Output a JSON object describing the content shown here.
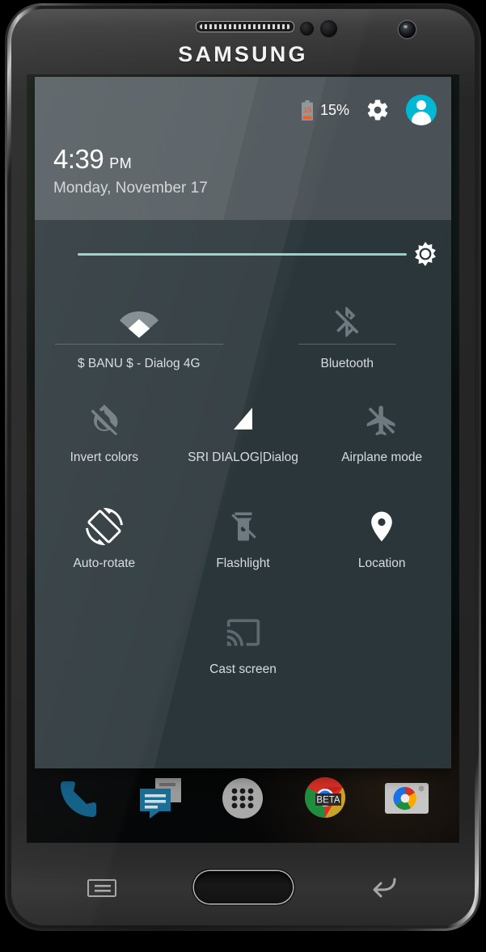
{
  "device": {
    "brand": "SAMSUNG",
    "speaker_icon": "earpiece-speaker",
    "camera_icon": "front-camera",
    "home_button": "home-button",
    "recent_button": "recent-apps-button",
    "back_button": "back-button"
  },
  "status": {
    "battery_level_text": "15",
    "battery_percent": "15%",
    "battery_icon": "battery-low-icon",
    "settings_icon": "gear-icon",
    "avatar_icon": "user-avatar-icon",
    "accent_cyan": "#00b8d4",
    "battery_warn_color": "#f4511e"
  },
  "clock": {
    "time": "4:39",
    "ampm": "PM",
    "date": "Monday, November 17"
  },
  "brightness": {
    "label": "brightness-slider",
    "value_percent": 92,
    "track_color": "#8fd3c8",
    "thumb_icon": "brightness-sun-icon"
  },
  "tiles": {
    "row1": [
      {
        "name": "wifi",
        "label": "$ BANU $ - Dialog 4G",
        "icon": "wifi-icon",
        "state": "on"
      },
      {
        "name": "bluetooth",
        "label": "Bluetooth",
        "icon": "bluetooth-off-icon",
        "state": "off"
      }
    ],
    "row2": [
      {
        "name": "invert-colors",
        "label": "Invert colors",
        "icon": "invert-colors-off-icon",
        "state": "off"
      },
      {
        "name": "mobile-data",
        "label": "SRI DIALOG|Dialog",
        "icon": "signal-bars-icon",
        "state": "on"
      },
      {
        "name": "airplane-mode",
        "label": "Airplane mode",
        "icon": "airplane-off-icon",
        "state": "off"
      }
    ],
    "row3": [
      {
        "name": "auto-rotate",
        "label": "Auto-rotate",
        "icon": "screen-rotation-icon",
        "state": "on"
      },
      {
        "name": "flashlight",
        "label": "Flashlight",
        "icon": "flashlight-off-icon",
        "state": "off"
      },
      {
        "name": "location",
        "label": "Location",
        "icon": "location-pin-icon",
        "state": "on"
      }
    ],
    "row4": [
      {
        "name": "cast-screen",
        "label": "Cast screen",
        "icon": "cast-screen-icon",
        "state": "off"
      }
    ]
  },
  "dock": [
    {
      "name": "phone",
      "icon": "phone-icon",
      "badge": ""
    },
    {
      "name": "messages",
      "icon": "messages-icon",
      "badge": ""
    },
    {
      "name": "app-drawer",
      "icon": "app-drawer-icon",
      "badge": ""
    },
    {
      "name": "chrome-beta",
      "icon": "chrome-icon",
      "badge": "BETA"
    },
    {
      "name": "camera",
      "icon": "camera-icon",
      "badge": ""
    }
  ],
  "theme": {
    "panel_bg": "#2b363b",
    "header_bg": "#4a5257",
    "label_color": "#d7dcde",
    "icon_on": "#ffffff",
    "icon_off": "#6e7a80"
  }
}
